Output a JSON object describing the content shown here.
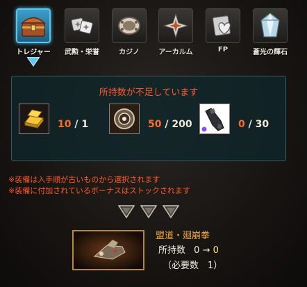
{
  "tabs": [
    {
      "label": "トレジャー",
      "icon": "treasure-chest-icon",
      "active": true
    },
    {
      "label": "武勲・栄誉",
      "icon": "dice-cards-icon",
      "active": false
    },
    {
      "label": "カジノ",
      "icon": "casino-chip-icon",
      "active": false
    },
    {
      "label": "アーカルム",
      "icon": "arcarum-star-icon",
      "active": false
    },
    {
      "label": "FP",
      "icon": "fp-heart-icon",
      "active": false
    },
    {
      "label": "蒼光の輝石",
      "icon": "crystal-icon",
      "active": false
    }
  ],
  "shortage_panel": {
    "title": "所持数が不足しています",
    "items": [
      {
        "icon": "gold-bar-icon",
        "current": "10",
        "required": "1"
      },
      {
        "icon": "orb-item-icon",
        "current": "50",
        "required": "200"
      },
      {
        "icon": "gauntlet-icon",
        "current": "0",
        "required": "30"
      }
    ],
    "separator": " / "
  },
  "notes": [
    "※装備は入手順が古いものから選択されます",
    "※装備に付加されているボーナスはストックされます"
  ],
  "selection_slots": 3,
  "reward": {
    "name": "盟道・廻崩拳",
    "owned_label": "所持数",
    "owned_from": "0",
    "arrow": "→",
    "owned_to": "0",
    "need_text": "（必要数　1）"
  },
  "colors": {
    "accent_blue": "#56c7ef",
    "warning_red": "#ff5a2a",
    "count_orange": "#ff6a25",
    "reward_name": "#f0a93a",
    "highlight_yellow": "#ffe36a"
  }
}
